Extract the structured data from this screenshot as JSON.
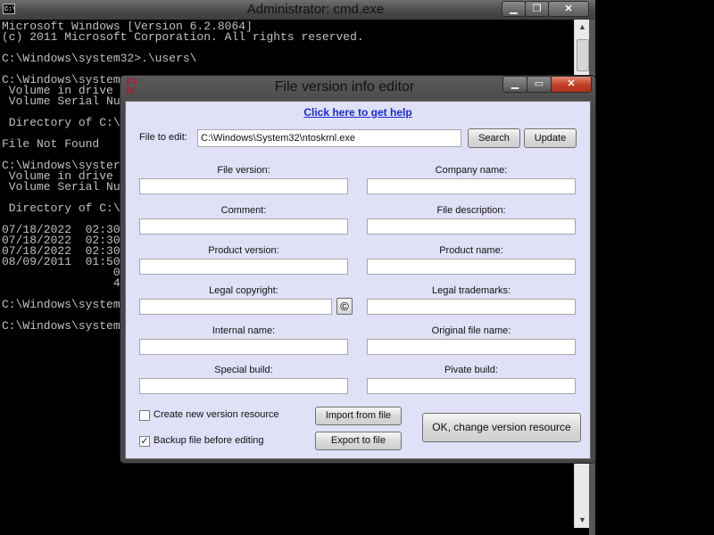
{
  "cmd": {
    "title": "Administrator: cmd.exe",
    "icon": "C:\\",
    "controls": {
      "minimize": "▁",
      "maximize": "❐",
      "close": "✕"
    },
    "lines": [
      "Microsoft Windows [Version 6.2.8064]",
      "(c) 2011 Microsoft Corporation. All rights reserved.",
      "",
      "C:\\Windows\\system32>.\\users\\",
      "",
      "C:\\Windows\\system3",
      " Volume in drive",
      " Volume Serial Nu",
      "",
      " Directory of C:\\",
      "",
      "File Not Found",
      "",
      "C:\\Windows\\syster",
      " Volume in drive",
      " Volume Serial Nu",
      "",
      " Directory of C:\\",
      "",
      "07/18/2022  02:30",
      "07/18/2022  02:30",
      "07/18/2022  02:30",
      "08/09/2011  01:50",
      "                0",
      "                4",
      "",
      "C:\\Windows\\system",
      "",
      "C:\\Windows\\system"
    ],
    "scroll": {
      "up": "▲",
      "down": "▼"
    }
  },
  "editor": {
    "title": "File version info editor",
    "icon_text": [
      "FV",
      "IE"
    ],
    "controls": {
      "minimize": "▁",
      "maximize": "▭",
      "close": "✕"
    },
    "help_link": "Click here to get help",
    "file_label": "File to edit:",
    "file_value": "C:\\Windows\\System32\\ntoskrnl.exe",
    "search_button": "Search",
    "update_button": "Update",
    "fields": {
      "file_version": "File version:",
      "company_name": "Company name:",
      "comment": "Comment:",
      "file_description": "File description:",
      "product_version": "Product version:",
      "product_name": "Product name:",
      "legal_copyright": "Legal copyright:",
      "legal_trademarks": "Legal trademarks:",
      "internal_name": "Internal name:",
      "original_file_name": "Original file name:",
      "special_build": "Special build:",
      "private_build": "Pivate build:"
    },
    "copyright_symbol": "©",
    "create_new_label": "Create new version resource",
    "create_new_checked": false,
    "backup_label": "Backup file before editing",
    "backup_checked": true,
    "check_mark": "✓",
    "import_button": "Import from file",
    "export_button": "Export to file",
    "ok_button": "OK, change version resource"
  }
}
